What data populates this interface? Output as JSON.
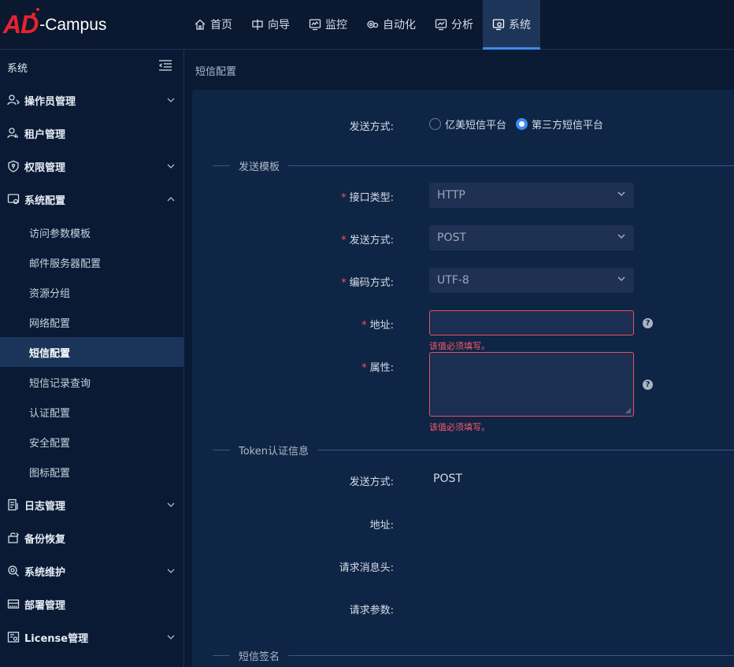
{
  "header": {
    "logo_main": "AD",
    "logo_rest": "-Campus",
    "nav": [
      {
        "label": "首页",
        "icon": "home-icon"
      },
      {
        "label": "向导",
        "icon": "guide-icon"
      },
      {
        "label": "监控",
        "icon": "monitor-icon"
      },
      {
        "label": "自动化",
        "icon": "automation-icon"
      },
      {
        "label": "分析",
        "icon": "analysis-icon"
      },
      {
        "label": "系统",
        "icon": "system-icon",
        "active": true
      }
    ]
  },
  "sidebar": {
    "title": "系统",
    "items": [
      {
        "label": "操作员管理",
        "icon": "operator-icon",
        "expandable": true
      },
      {
        "label": "租户管理",
        "icon": "tenant-icon",
        "expandable": false
      },
      {
        "label": "权限管理",
        "icon": "shield-icon",
        "expandable": true
      },
      {
        "label": "系统配置",
        "icon": "config-icon",
        "expandable": true,
        "expanded": true
      },
      {
        "label": "日志管理",
        "icon": "log-icon",
        "expandable": true
      },
      {
        "label": "备份恢复",
        "icon": "backup-icon",
        "expandable": false
      },
      {
        "label": "系统维护",
        "icon": "maintenance-icon",
        "expandable": true
      },
      {
        "label": "部署管理",
        "icon": "deploy-icon",
        "expandable": false
      },
      {
        "label": "License管理",
        "icon": "license-icon",
        "expandable": true
      }
    ],
    "sub_items": [
      "访问参数模板",
      "邮件服务器配置",
      "资源分组",
      "网络配置",
      "短信配置",
      "短信记录查询",
      "认证配置",
      "安全配置",
      "图标配置"
    ],
    "active_sub": "短信配置"
  },
  "breadcrumb": "短信配置",
  "form": {
    "send_method_label": "发送方式:",
    "radio_options": [
      "亿美短信平台",
      "第三方短信平台"
    ],
    "radio_selected": "第三方短信平台",
    "section_template": "发送模板",
    "interface_type_label": "接口类型:",
    "interface_type_value": "HTTP",
    "method_label": "发送方式:",
    "method_value": "POST",
    "encoding_label": "编码方式:",
    "encoding_value": "UTF-8",
    "address_label": "地址:",
    "address_value": "",
    "address_error": "该值必须填写。",
    "attr_label": "属性:",
    "attr_value": "",
    "attr_error": "该值必须填写。",
    "help_glyph": "?",
    "required_mark": "*",
    "section_token": "Token认证信息",
    "token_method_label": "发送方式:",
    "token_method_value": "POST",
    "token_address_label": "地址:",
    "token_header_label": "请求消息头:",
    "token_params_label": "请求参数:",
    "section_signature": "短信签名"
  },
  "colors": {
    "accent": "#3b8cf0",
    "error": "#ff4d5e",
    "logo_red": "#e8232f"
  }
}
